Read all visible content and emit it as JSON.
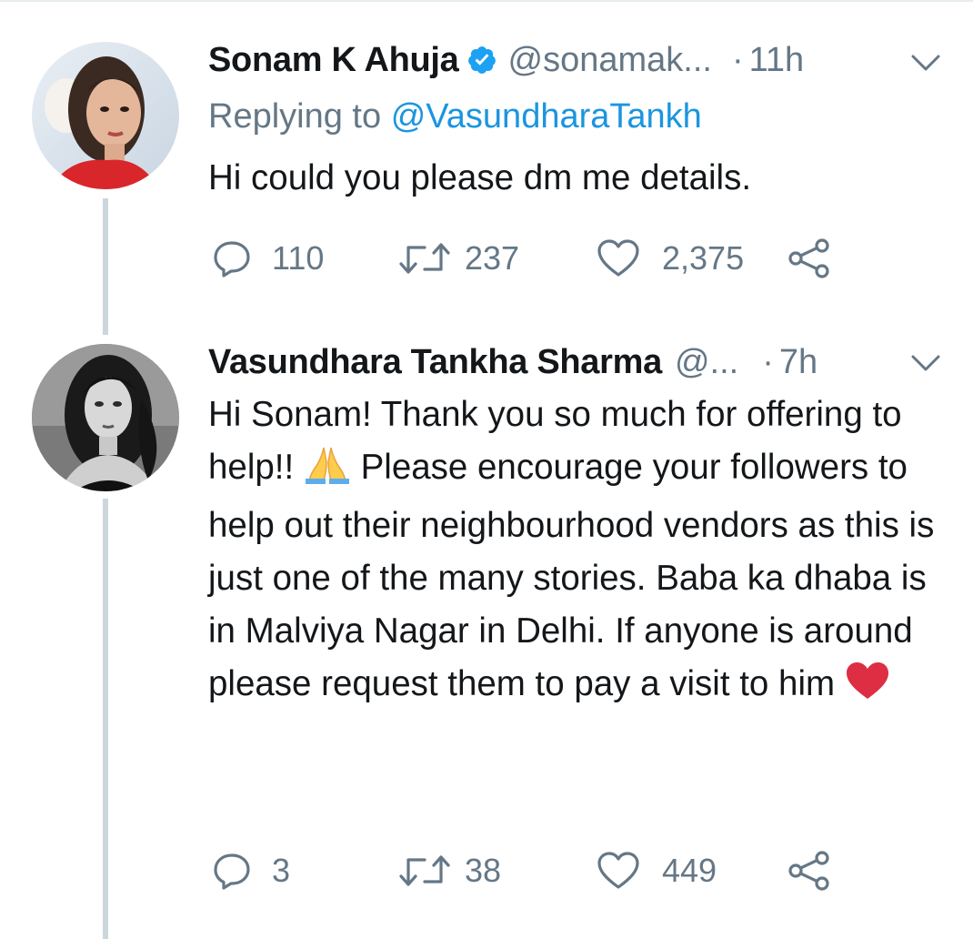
{
  "tweets": [
    {
      "name": "Sonam K Ahuja",
      "handle": "@sonamak...",
      "dot": "·",
      "time": "11h",
      "replying_label": "Replying to",
      "replying_mention": "@VasundharaTankh",
      "text": "Hi could you please dm me details.",
      "replies": "110",
      "retweets": "237",
      "likes": "2,375",
      "verified": true
    },
    {
      "name": "Vasundhara Tankha Sharma",
      "handle": "@...",
      "dot": "·",
      "time": "7h",
      "text_parts": {
        "p1": "Hi Sonam! Thank you so much for offering to help!!",
        "emoji1": "folded-hands-emoji",
        "p2": "Please encourage your followers to help out their neighbourhood vendors as this is just one of the many stories. Baba ka dhaba is in Malviya Nagar in Delhi. If anyone is around please request them to pay a visit to him",
        "emoji2": "red-heart-emoji"
      },
      "replies": "3",
      "retweets": "38",
      "likes": "449",
      "verified": false
    }
  ],
  "colors": {
    "text": "#14171a",
    "secondary": "#657786",
    "link": "#1b95e0",
    "verified": "#1da1f2",
    "thread_line": "#ccd6dd",
    "heart": "#e0245e"
  }
}
